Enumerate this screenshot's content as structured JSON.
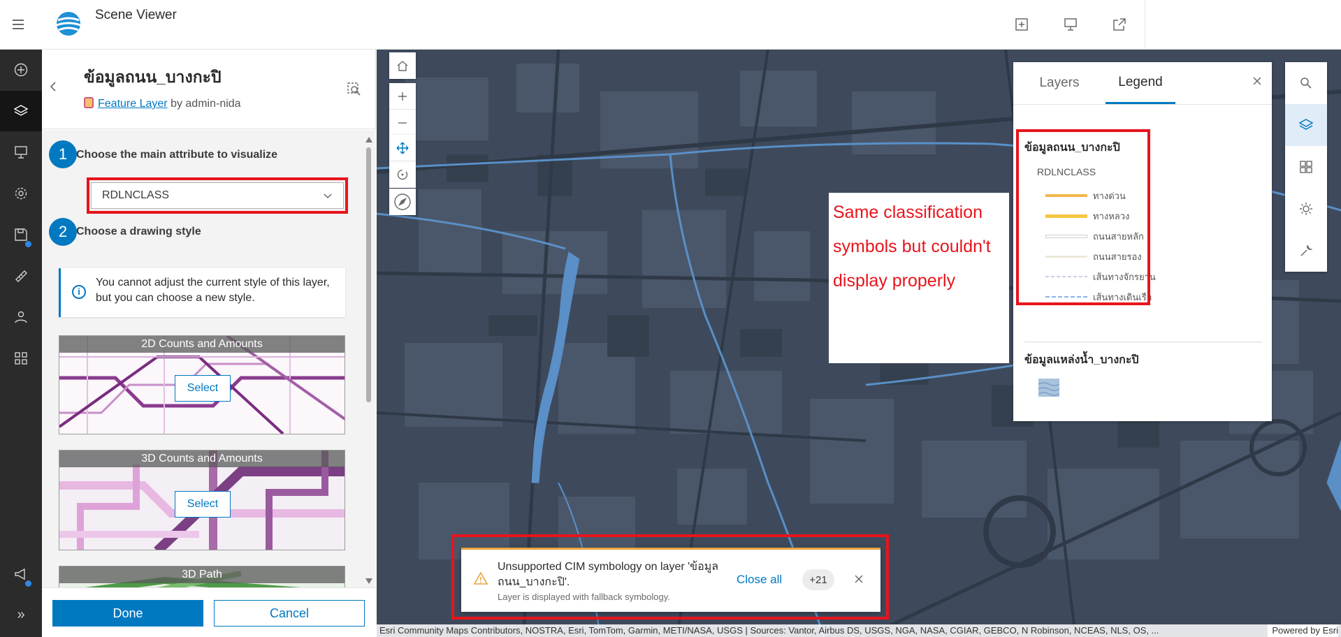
{
  "header": {
    "app_title": "Scene Viewer",
    "menu_icon": "hamburger-menu-icon",
    "actions": [
      "add-icon",
      "presentation-icon",
      "share-icon"
    ]
  },
  "left_rail": {
    "items": [
      "add-icon",
      "layers-icon",
      "slides-icon",
      "settings-icon",
      "save-icon",
      "measure-icon",
      "people-icon",
      "apps-icon"
    ],
    "bottom": [
      "announcement-icon",
      "expand-icon"
    ],
    "expand_label": "»"
  },
  "panel": {
    "layer_title": "ข้อมูลถนน_บางกะปิ",
    "layer_type": "Feature Layer",
    "owner_prefix": "by admin-nida",
    "step1_number": "1",
    "step1_label": "Choose the main attribute to visualize",
    "attribute_value": "RDLNCLASS",
    "step2_number": "2",
    "step2_label": "Choose a drawing style",
    "notice": "You cannot adjust the current style of this layer, but you can choose a new style.",
    "styles": [
      {
        "name": "2D Counts and Amounts",
        "button": "Select"
      },
      {
        "name": "3D Counts and Amounts",
        "button": "Select"
      },
      {
        "name": "3D Path"
      }
    ],
    "done_label": "Done",
    "cancel_label": "Cancel"
  },
  "map": {
    "annotation": "Same classification symbols but couldn't display properly",
    "legend": {
      "tabs": [
        "Layers",
        "Legend"
      ],
      "active_tab": "Legend",
      "layer1_title": "ข้อมูลถนน_บางกะปิ",
      "field": "RDLNCLASS",
      "items": [
        {
          "label": "ทางด่วน",
          "color": "#f0b84b"
        },
        {
          "label": "ทางหลวง",
          "color": "#f5c842"
        },
        {
          "label": "ถนนสายหลัก",
          "color": "#e6e6e6"
        },
        {
          "label": "ถนนสายรอง",
          "color": "#ede8d8"
        },
        {
          "label": "เส้นทางจักรยาน",
          "color": "#d8dcef"
        },
        {
          "label": "เส้นทางเดินเรือ",
          "color": "#8ab4e8"
        }
      ],
      "layer2_title": "ข้อมูลแหล่งน้ำ_บางกะปิ"
    },
    "toast": {
      "title": "Unsupported CIM symbology on layer 'ข้อมูลถนน_บางกะปิ'.",
      "subtitle": "Layer is displayed with fallback symbology.",
      "close_all": "Close all",
      "count": "+21"
    },
    "attribution": "Esri Community Maps Contributors, NOSTRA, Esri, TomTom, Garmin, METI/NASA, USGS | Sources: Vantor, Airbus DS, USGS, NGA, NASA, CGIAR, GEBCO, N Robinson, NCEAS, NLS, OS, ...",
    "powered_by": "Powered by Esri"
  },
  "colors": {
    "accent": "#0079c1",
    "highlight_red": "#e8141c",
    "warning": "#e8a33b",
    "map_base": "#3e4a5c",
    "water": "#5a8fc7"
  }
}
